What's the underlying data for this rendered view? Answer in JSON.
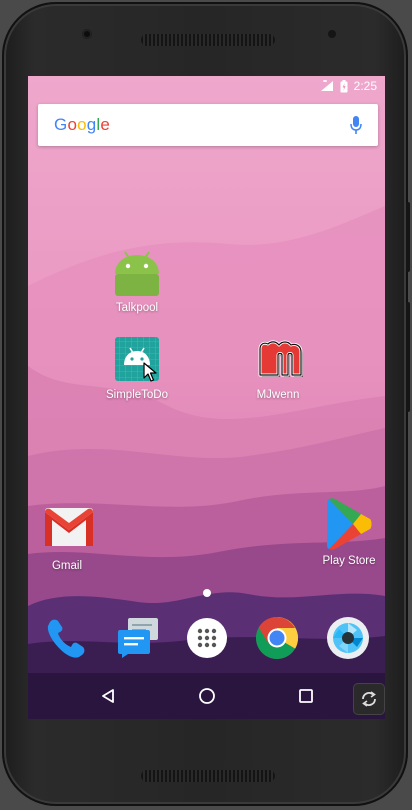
{
  "status_bar": {
    "time": "2:25",
    "icons": [
      "signal-icon",
      "battery-icon"
    ]
  },
  "search_bar": {
    "logo_letters": [
      "G",
      "o",
      "o",
      "g",
      "l",
      "e"
    ],
    "logo_colors": [
      "#4285F4",
      "#EA4335",
      "#FBBC05",
      "#4285F4",
      "#34A853",
      "#EA4335"
    ],
    "mic_icon": "mic-icon"
  },
  "home_apps": [
    {
      "label": "Talkpool",
      "icon": "android-icon"
    },
    {
      "label": "SimpleToDo",
      "icon": "android-grid-icon"
    },
    {
      "label": "MJwenn",
      "icon": "mjwenn-m-icon"
    },
    {
      "label": "Gmail",
      "icon": "gmail-icon"
    },
    {
      "label": "Play Store",
      "icon": "play-store-icon"
    }
  ],
  "dock": [
    {
      "icon": "phone-icon"
    },
    {
      "icon": "messages-icon"
    },
    {
      "icon": "app-drawer-icon"
    },
    {
      "icon": "chrome-icon"
    },
    {
      "icon": "camera-icon"
    }
  ],
  "nav": {
    "back": "back-icon",
    "home": "home-icon",
    "recents": "recents-icon"
  },
  "colors": {
    "wallpaper_top": "#EFA5CC",
    "wallpaper_bottom": "#2A1540",
    "android_green": "#8BC34A",
    "teal": "#1FA39C",
    "mic_blue": "#4285F4",
    "phone_blue": "#2196F3",
    "gmail_red": "#D93025"
  }
}
